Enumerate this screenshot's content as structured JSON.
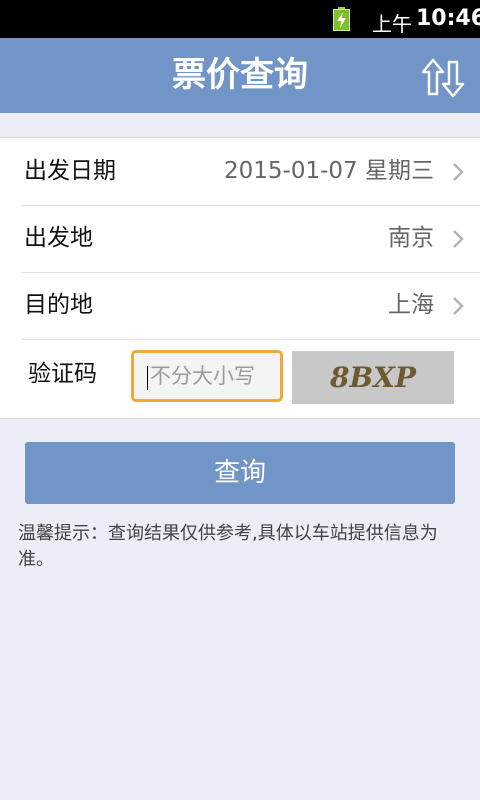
{
  "status_bar": {
    "ampm": "上午",
    "time": "10:46"
  },
  "header": {
    "title": "票价查询"
  },
  "form": {
    "departure_date": {
      "label": "出发日期",
      "value": "2015-01-07 星期三"
    },
    "origin": {
      "label": "出发地",
      "value": "南京"
    },
    "destination": {
      "label": "目的地",
      "value": "上海"
    },
    "captcha": {
      "label": "验证码",
      "placeholder": "不分大小写",
      "image_text": "8BXP"
    }
  },
  "query_button": {
    "label": "查询"
  },
  "tip": "温馨提示：查询结果仅供参考,具体以车站提供信息为准。",
  "colors": {
    "accent": "#7095c6",
    "focus_border": "#f0a83a",
    "background": "#ecedf7"
  }
}
